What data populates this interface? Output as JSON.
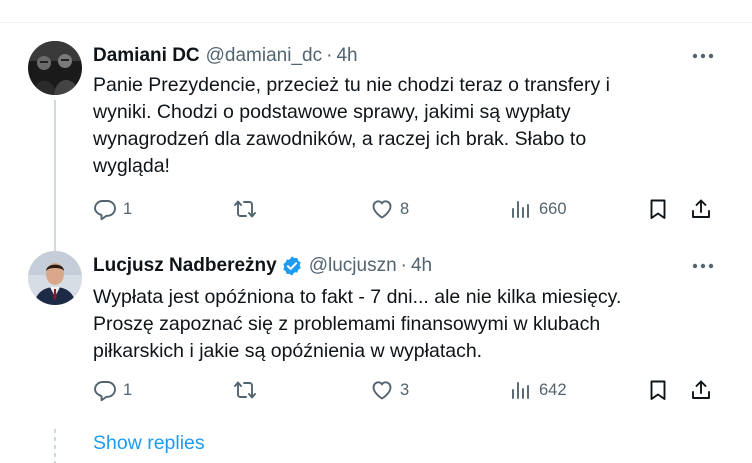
{
  "tweets": [
    {
      "author": "Damiani DC",
      "handle": "@damiani_dc",
      "separator": "·",
      "time": "4h",
      "verified": false,
      "text": "Panie Prezydencie, przecież tu nie chodzi teraz o transfery i\nwyniki. Chodzi o podstawowe sprawy, jakimi są wypłaty\nwynagrodzeń dla zawodników, a raczej ich brak. Słabo to\nwygląda!",
      "replies": "1",
      "retweets": "",
      "likes": "8",
      "views": "660"
    },
    {
      "author": "Lucjusz Nadbereżny",
      "handle": "@lucjuszn",
      "separator": "·",
      "time": "4h",
      "verified": true,
      "text": "Wypłata jest opóźniona to fakt - 7 dni... ale nie kilka miesięcy.\nProszę zapoznać się z problemami finansowymi w klubach\npiłkarskich i jakie są opóźnienia w wypłatach.",
      "replies": "1",
      "retweets": "",
      "likes": "3",
      "views": "642"
    }
  ],
  "show_replies_label": "Show replies",
  "colors": {
    "accent": "#1d9bf0",
    "text": "#0f1419",
    "muted": "#536471",
    "border": "#eff3f4"
  },
  "icons": [
    "reply-icon",
    "retweet-icon",
    "like-icon",
    "views-icon",
    "bookmark-icon",
    "share-icon",
    "more-icon",
    "verified-icon"
  ]
}
